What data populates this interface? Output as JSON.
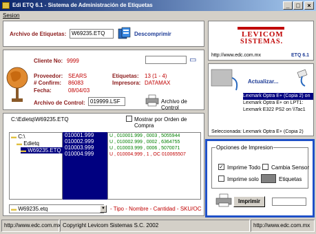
{
  "title": "Edi ETQ 6.1 - Sistema de Administración de Etiquetas",
  "menu": "Sesion",
  "archivo_label": "Archivo de Etiquetas:",
  "archivo_value": "W69235.ETQ",
  "descomprimir": "Descomprimir",
  "logo_top": "LEVICOM",
  "logo_bottom": "SISTEMAS.",
  "logo_url": "http://www.edc.com.mx",
  "version": "ETQ 6.1",
  "cliente_label": "Cliente No:",
  "cliente_value": "9999",
  "proveedor_label": "Proveedor:",
  "proveedor_value": "SEARS",
  "confirm_label": "# Confirm:",
  "confirm_value": "86083",
  "fecha_label": "Fecha:",
  "fecha_value": "08/04/03",
  "etiquetas_label": "Etiquetas:",
  "etiquetas_value": "13 (1 - 4)",
  "impresora_label": "Impresora:",
  "impresora_value": "DATAMAX",
  "control_label": "Archivo de Control:",
  "control_value": "019999.LSF",
  "control_btn": "Archivo de Control",
  "actualizar": "Actualizar...",
  "printers": [
    "Lexmark Optra E+ (Copia 2) on",
    "Lexmark Optra E+ on LPT1:",
    "Lexmark E322 PS2 on \\\\Tac1"
  ],
  "seleccionada": "Seleccionada: Lexmark Optra E+ (Copia 2)",
  "path": "C:\\Edietq\\W69235.ETQ",
  "orden_label": "Mostrar por Orden de Compra",
  "tree": [
    "C:\\",
    "Edietq",
    "W69235.ETQ"
  ],
  "files": [
    "010001.999",
    "010002.999",
    "010003.999",
    "010004.999"
  ],
  "records": [
    "U , 010001.999 , 0003 , 5055944",
    "U , 010002.999 , 0002 , 6364755",
    "U , 010003.999 , 0006 , 5070071",
    "U , 010004.999 , 1 , OC 010065507"
  ],
  "combo_value": "W69235.etq",
  "legend": "- Tipo - Nombre - Cantidad - SKU/OC",
  "opciones_title": "Opciones de Impresion",
  "imprime_todo": "Imprime Todo",
  "cambia_sensor": "Cambia Sensor",
  "imprime_solo": "Imprime solo",
  "etiquetas_chk": "Etiquetas",
  "imprimir": "Imprimir",
  "status1": "http://www.edc.com.mx",
  "status2": "Copyright Levicom Sistemas S.C. 2002",
  "status3": "http://www.edc.com.mx",
  "colors": {
    "title": "#0a246a",
    "selection": "#000080",
    "accent_blue": "#1e50c8",
    "label_red": "#8b1a1a",
    "green": "#008000"
  }
}
